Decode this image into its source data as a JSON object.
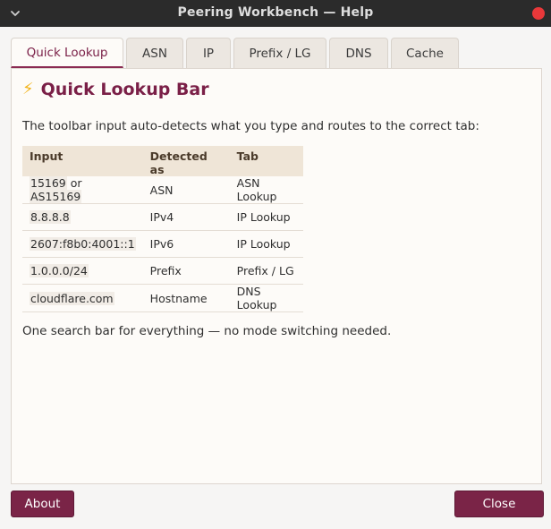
{
  "window": {
    "title": "Peering Workbench — Help",
    "close_color": "#e9383a"
  },
  "tabs": [
    {
      "label": "Quick Lookup",
      "active": true
    },
    {
      "label": "ASN",
      "active": false
    },
    {
      "label": "IP",
      "active": false
    },
    {
      "label": "Prefix / LG",
      "active": false
    },
    {
      "label": "DNS",
      "active": false
    },
    {
      "label": "Cache",
      "active": false
    }
  ],
  "content": {
    "icon": "lightning-bolt-icon",
    "heading": "Quick Lookup Bar",
    "intro": "The toolbar input auto-detects what you type and routes to the correct tab:",
    "table": {
      "headers": [
        "Input",
        "Detected as",
        "Tab"
      ],
      "rows": [
        {
          "input_a": "15169",
          "or": " or ",
          "input_b": "AS15169",
          "detected": "ASN",
          "tab": "ASN Lookup"
        },
        {
          "input_a": "8.8.8.8",
          "detected": "IPv4",
          "tab": "IP Lookup"
        },
        {
          "input_a": "2607:f8b0:4001::1",
          "detected": "IPv6",
          "tab": "IP Lookup"
        },
        {
          "input_a": "1.0.0.0/24",
          "detected": "Prefix",
          "tab": "Prefix / LG"
        },
        {
          "input_a": "cloudflare.com",
          "detected": "Hostname",
          "tab": "DNS Lookup"
        }
      ]
    },
    "outro": "One search bar for everything — no mode switching needed."
  },
  "buttons": {
    "about": "About",
    "close": "Close"
  },
  "colors": {
    "accent": "#7a1f47",
    "button": "#7a2447",
    "table_header": "#efe5d7"
  }
}
